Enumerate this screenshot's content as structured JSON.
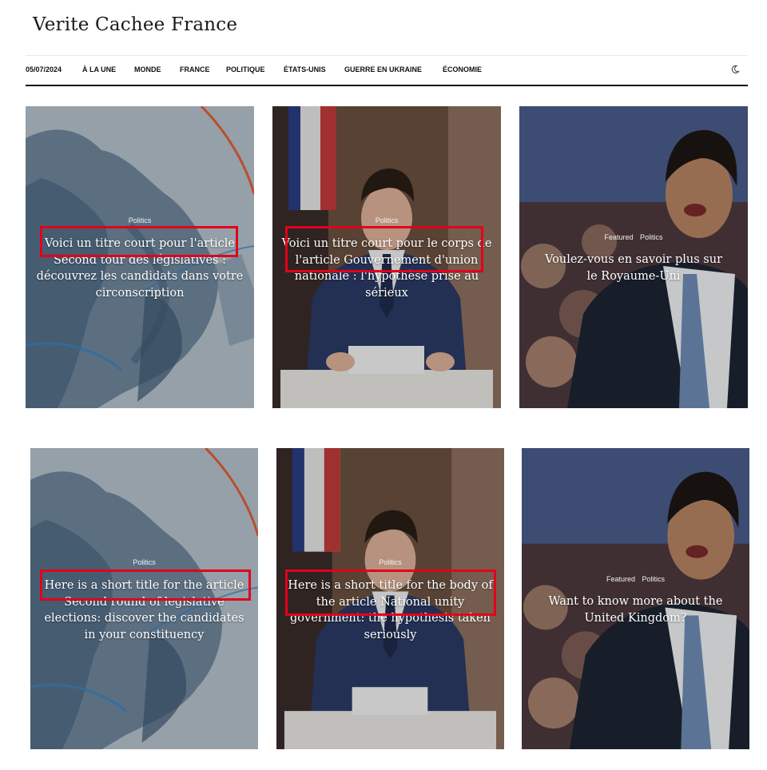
{
  "header": {
    "brand": "Verite Cachee France"
  },
  "nav": {
    "date": "05/07/2024",
    "items": [
      "À LA UNE",
      "MONDE",
      "FRANCE",
      "POLITIQUE",
      "ÉTATS-UNIS",
      "GUERRE EN UKRAINE",
      "ÉCONOMIE"
    ],
    "theme_icon": "moon-icon"
  },
  "cards": [
    {
      "categories": [
        "Politics"
      ],
      "title": "Voici un titre court pour l'article Second tour des législatives : découvrez les candidats dans votre circonscription",
      "image": "france-map"
    },
    {
      "categories": [
        "Politics"
      ],
      "title": "Voici un titre court pour le corps de l'article Gouvernement d'union nationale : l'hypothèse prise au sérieux",
      "image": "man-at-podium"
    },
    {
      "categories": [
        "Featured",
        "Politics"
      ],
      "title": "Voulez-vous en savoir plus sur le Royaume-Uni",
      "image": "man-speaking"
    },
    {
      "categories": [
        "Politics"
      ],
      "title": "Here is a short title for the article Second round of legislative elections: discover the candidates in your constituency",
      "image": "france-map"
    },
    {
      "categories": [
        "Politics"
      ],
      "title": "Here is a short title for the body of the article National unity government: the hypothesis taken seriously",
      "image": "man-at-podium"
    },
    {
      "categories": [
        "Featured",
        "Politics"
      ],
      "title": "Want to know more about the United Kingdom?",
      "image": "man-speaking"
    }
  ],
  "colors": {
    "highlight": "#e3001b",
    "map_bg": "#b6c3cc",
    "suit": "#2b3b66"
  }
}
